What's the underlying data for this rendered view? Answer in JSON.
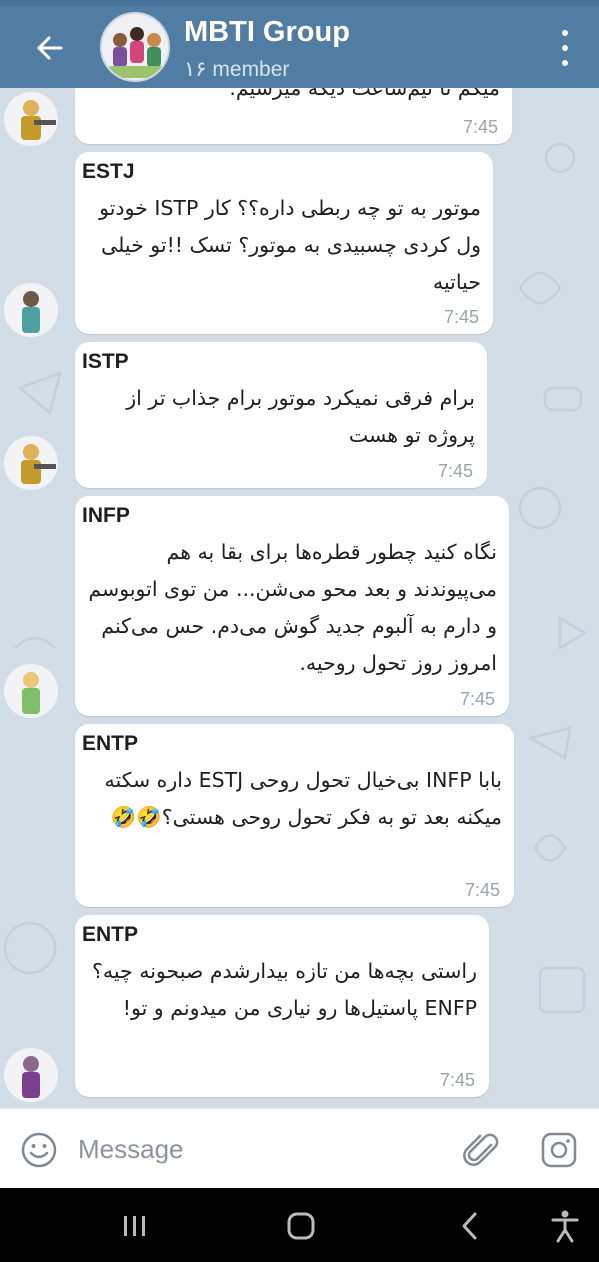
{
  "header": {
    "title": "MBTI Group",
    "subtitle": "۱۶ member",
    "back_icon": "arrow-left-icon",
    "menu_icon": "more-vertical-icon"
  },
  "colors": {
    "header_bg": "#517da2",
    "chat_bg": "#d3dde6",
    "bubble_bg": "#ffffff",
    "time_text": "#9aa4ad"
  },
  "messages": [
    {
      "sender": "",
      "text": "میگم تا نیم‌ساعت دیگه میرسیم.",
      "time": "7:45"
    },
    {
      "sender": "ESTJ",
      "text": "موتور به تو چه ربطی داره؟؟ کار ISTP خودتو ول کردی چسبیدی به موتور؟ تسک !!تو خیلی حیاتیه",
      "time": "7:45"
    },
    {
      "sender": "ISTP",
      "text": "برام فرقی نمیکرد موتور برام جذاب تر از پروژه تو هست",
      "time": "7:45"
    },
    {
      "sender": "INFP",
      "text": "نگاه کنید چطور قطره‌ها برای بقا به هم می‌پیوندند و بعد محو می‌شن... من توی اتوبوسم و دارم به آلبوم جدید گوش می‌دم. حس می‌کنم امروز روز تحول روحیه.",
      "time": "7:45"
    },
    {
      "sender": "ENTP",
      "text": "بابا INFP بی‌خیال تحول روحی ESTJ داره سکته میکنه بعد تو به فکر تحول روحی هستی؟🤣🤣",
      "time": "7:45"
    },
    {
      "sender": "ENTP",
      "text": "راستی بچه‌ها من تازه بیدارشدم صبحونه چیه؟ ENFP پاستیل‌ها رو نیاری من میدونم و تو!",
      "time": "7:45"
    }
  ],
  "input": {
    "placeholder": "Message",
    "value": "",
    "emoji_icon": "emoji-icon",
    "attach_icon": "paperclip-icon",
    "camera_icon": "camera-icon"
  },
  "navbar": {
    "recent_icon": "recent-apps-icon",
    "home_icon": "home-icon",
    "back_icon": "nav-back-icon",
    "accessibility_icon": "accessibility-icon"
  }
}
